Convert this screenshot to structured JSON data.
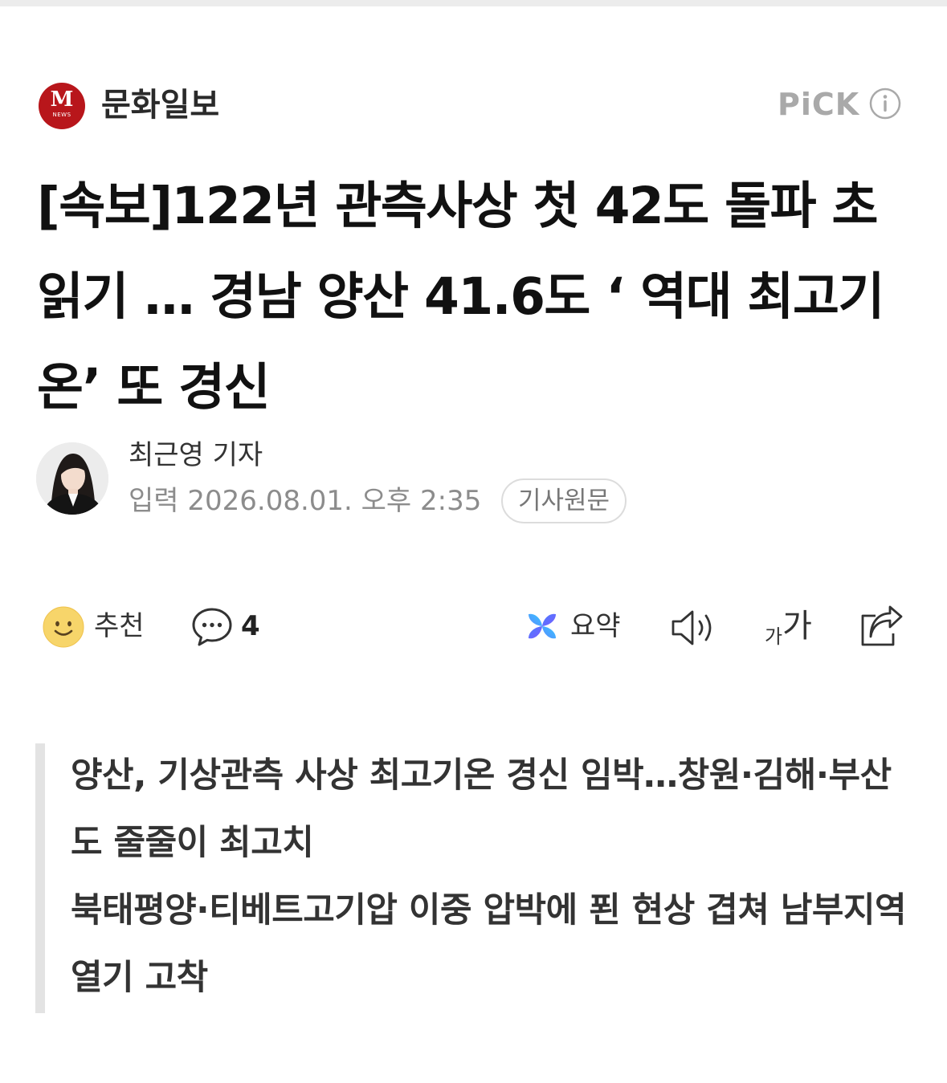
{
  "press": {
    "logo_letter": "M",
    "logo_sub": "NEWS",
    "name": "문화일보",
    "brand_color": "#b8161b"
  },
  "pick_label": "PiCK",
  "headline": "[속보]122년 관측사상 첫 42도 돌파 초읽기 … 경남 양산 41.6도 ‘ 역대 최고기온’ 또 경신",
  "reporter": {
    "name": "최근영 기자",
    "date": "입력 2026.08.01. 오후 2:35",
    "original_button": "기사원문"
  },
  "actions": {
    "like_label": "추천",
    "comment_count": "4",
    "summary_label": "요약",
    "font_small": "가",
    "font_large": "가"
  },
  "subheads": [
    "양산, 기상관측 사상 최고기온 경신 임박…창원·김해·부산도 줄줄이 최고치",
    "북태평양·티베트고기압 이중 압박에 푄 현상 겹쳐 남부지역 열기 고착"
  ],
  "icons": {
    "logo": "press-logo-icon",
    "info": "info-icon",
    "like": "smile-icon",
    "comment": "speech-bubble-icon",
    "summary": "ai-summary-icon",
    "tts": "speaker-icon",
    "font_size": "font-size-icon",
    "share": "share-icon"
  }
}
